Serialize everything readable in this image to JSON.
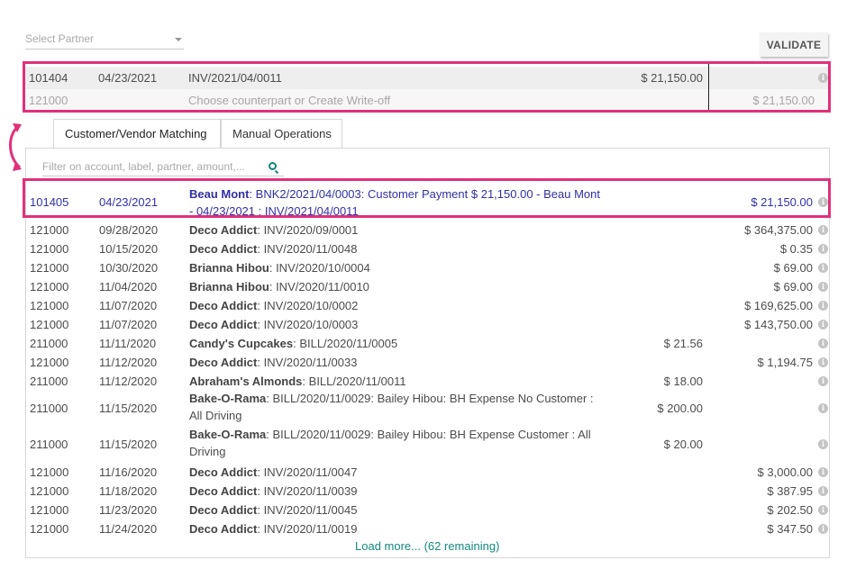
{
  "partner_select": {
    "placeholder": "Select Partner"
  },
  "validate_label": "VALIDATE",
  "statement_lines": [
    {
      "account": "101404",
      "date": "04/23/2021",
      "label": "INV/2021/04/0011",
      "debit": "$ 21,150.00",
      "credit": ""
    },
    {
      "account": "121000",
      "date": "",
      "label": "Choose counterpart or Create Write-off",
      "debit": "",
      "credit": "$ 21,150.00"
    }
  ],
  "tabs": [
    {
      "label": "Customer/Vendor Matching",
      "active": true
    },
    {
      "label": "Manual Operations",
      "active": false
    }
  ],
  "filter": {
    "placeholder": "Filter on account, label, partner, amount,..."
  },
  "selected_line": {
    "account": "101405",
    "date": "04/23/2021",
    "partner": "Beau Mont",
    "label": ": BNK2/2021/04/0003: Customer Payment $ 21,150.00 - Beau Mont - 04/23/2021 : INV/2021/04/0011",
    "debit": "",
    "credit": "$ 21,150.00"
  },
  "proposition_lines": [
    {
      "account": "121000",
      "date": "09/28/2020",
      "partner": "Deco Addict",
      "label": ": INV/2020/09/0001",
      "debit": "",
      "credit": "$ 364,375.00"
    },
    {
      "account": "121000",
      "date": "10/15/2020",
      "partner": "Deco Addict",
      "label": ": INV/2020/11/0048",
      "debit": "",
      "credit": "$ 0.35"
    },
    {
      "account": "121000",
      "date": "10/30/2020",
      "partner": "Brianna Hibou",
      "label": ": INV/2020/10/0004",
      "debit": "",
      "credit": "$ 69.00"
    },
    {
      "account": "121000",
      "date": "11/04/2020",
      "partner": "Brianna Hibou",
      "label": ": INV/2020/11/0010",
      "debit": "",
      "credit": "$ 69.00"
    },
    {
      "account": "121000",
      "date": "11/07/2020",
      "partner": "Deco Addict",
      "label": ": INV/2020/10/0002",
      "debit": "",
      "credit": "$ 169,625.00"
    },
    {
      "account": "121000",
      "date": "11/07/2020",
      "partner": "Deco Addict",
      "label": ": INV/2020/10/0003",
      "debit": "",
      "credit": "$ 143,750.00"
    },
    {
      "account": "211000",
      "date": "11/11/2020",
      "partner": "Candy's Cupcakes",
      "label": ": BILL/2020/11/0005",
      "debit": "$ 21.56",
      "credit": ""
    },
    {
      "account": "121000",
      "date": "11/12/2020",
      "partner": "Deco Addict",
      "label": ": INV/2020/11/0033",
      "debit": "",
      "credit": "$ 1,194.75"
    },
    {
      "account": "211000",
      "date": "11/12/2020",
      "partner": "Abraham's Almonds",
      "label": ": BILL/2020/11/0011",
      "debit": "$ 18.00",
      "credit": ""
    },
    {
      "account": "211000",
      "date": "11/15/2020",
      "partner": "Bake-O-Rama",
      "label": ": BILL/2020/11/0029: Bailey Hibou: BH Expense No Customer : All Driving",
      "debit": "$ 200.00",
      "credit": ""
    },
    {
      "account": "211000",
      "date": "11/15/2020",
      "partner": "Bake-O-Rama",
      "label": ": BILL/2020/11/0029: Bailey Hibou: BH Expense Customer : All Driving",
      "debit": "$ 20.00",
      "credit": ""
    },
    {
      "account": "121000",
      "date": "11/16/2020",
      "partner": "Deco Addict",
      "label": ": INV/2020/11/0047",
      "debit": "",
      "credit": "$ 3,000.00"
    },
    {
      "account": "121000",
      "date": "11/18/2020",
      "partner": "Deco Addict",
      "label": ": INV/2020/11/0039",
      "debit": "",
      "credit": "$ 387.95"
    },
    {
      "account": "121000",
      "date": "11/23/2020",
      "partner": "Deco Addict",
      "label": ": INV/2020/11/0045",
      "debit": "",
      "credit": "$ 202.50"
    },
    {
      "account": "121000",
      "date": "11/24/2020",
      "partner": "Deco Addict",
      "label": ": INV/2020/11/0019",
      "debit": "",
      "credit": "$ 347.50"
    }
  ],
  "load_more": "Load more... (62 remaining)",
  "colors": {
    "highlight": "#e0307a",
    "link": "#128a7f",
    "selected": "#3030a8"
  },
  "icons": [
    "chevron-down-icon",
    "info-icon",
    "search-icon",
    "double-arrow-icon"
  ]
}
